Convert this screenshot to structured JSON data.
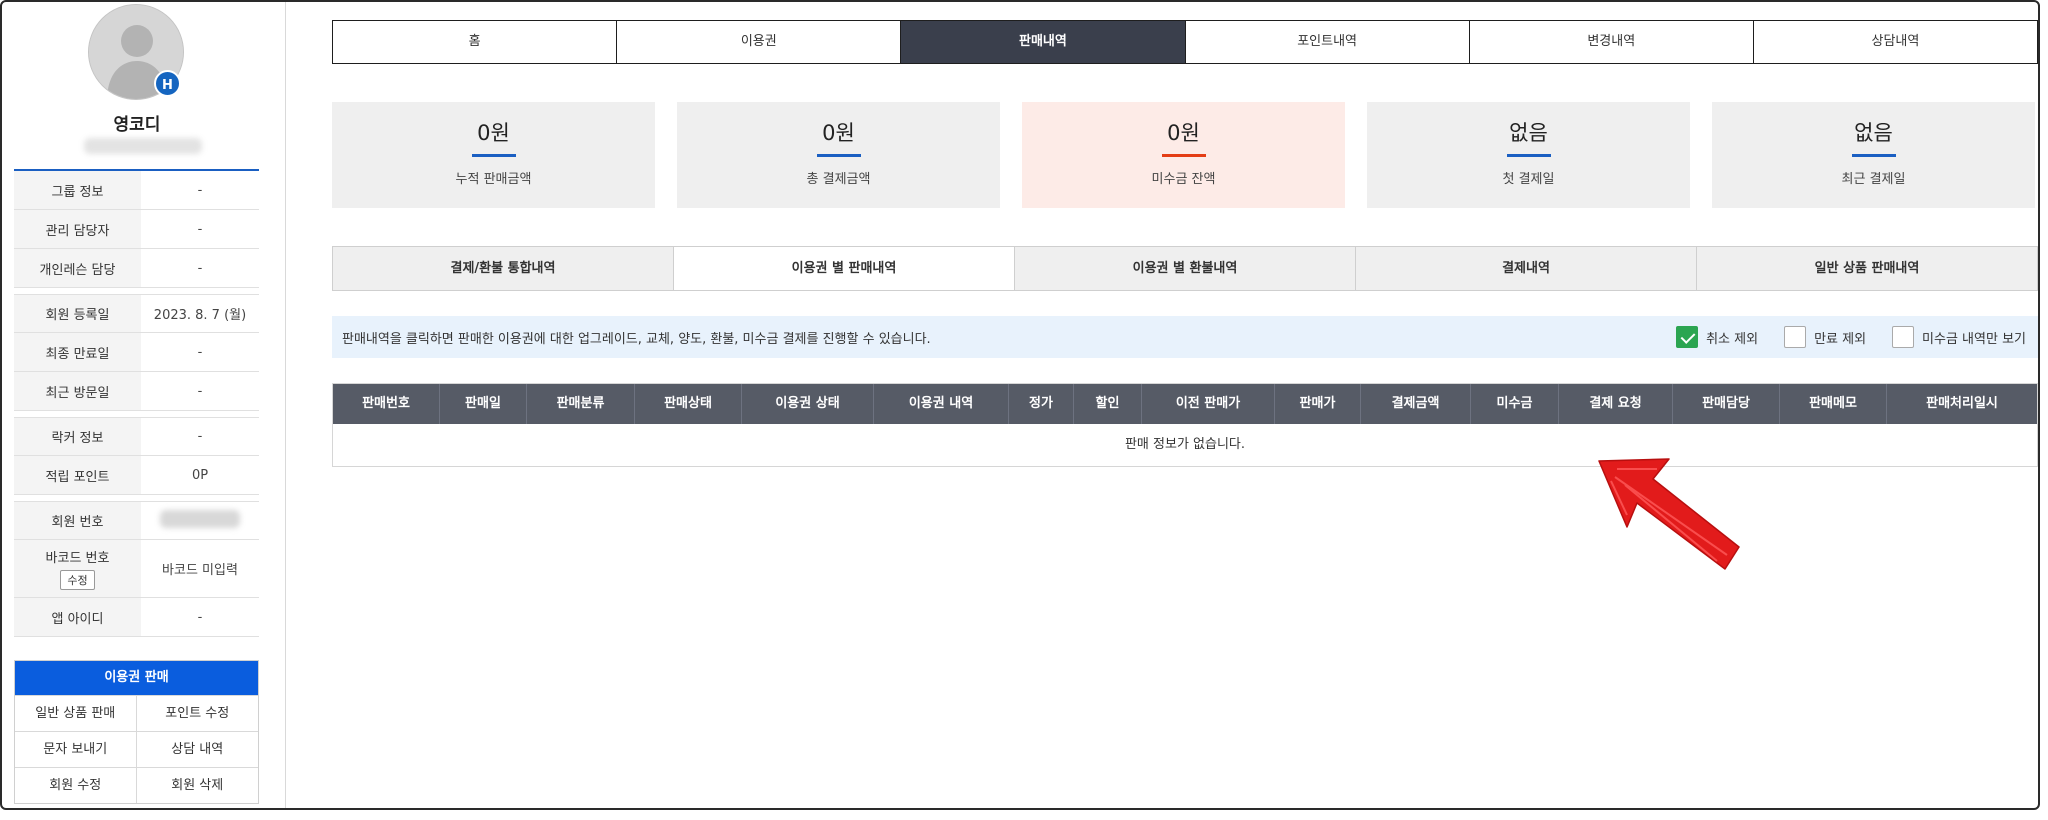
{
  "profile": {
    "badge": "H",
    "name": "영코디"
  },
  "info_rows": [
    {
      "label": "그룹 정보",
      "value": "-"
    },
    {
      "label": "관리 담당자",
      "value": "-"
    },
    {
      "label": "개인레슨 담당",
      "value": "-"
    },
    {
      "label": "회원 등록일",
      "value": "2023. 8. 7 (월)"
    },
    {
      "label": "최종 만료일",
      "value": "-"
    },
    {
      "label": "최근 방문일",
      "value": "-"
    },
    {
      "label": "락커 정보",
      "value": "-"
    },
    {
      "label": "적립 포인트",
      "value": "0P"
    },
    {
      "label": "회원 번호",
      "value": ""
    },
    {
      "label": "바코드 번호",
      "value": "바코드 미입력",
      "button": "수정"
    },
    {
      "label": "앱 아이디",
      "value": "-"
    }
  ],
  "actions": {
    "header": "이용권 판매",
    "items": [
      "일반 상품 판매",
      "포인트 수정",
      "문자 보내기",
      "상담 내역",
      "회원 수정",
      "회원 삭제"
    ]
  },
  "top_tabs": [
    "홈",
    "이용권",
    "판매내역",
    "포인트내역",
    "변경내역",
    "상담내역"
  ],
  "active_top_tab": "판매내역",
  "summary_cards": [
    {
      "value": "0원",
      "label": "누적 판매금액"
    },
    {
      "value": "0원",
      "label": "총 결제금액"
    },
    {
      "value": "0원",
      "label": "미수금 잔액"
    },
    {
      "value": "없음",
      "label": "첫 결제일"
    },
    {
      "value": "없음",
      "label": "최근 결제일"
    }
  ],
  "sub_tabs": [
    "결제/환불 통합내역",
    "이용권 별 판매내역",
    "이용권 별 환불내역",
    "결제내역",
    "일반 상품 판매내역"
  ],
  "active_sub_tab": "이용권 별 판매내역",
  "notice": "판매내역을 클릭하면 판매한 이용권에 대한 업그레이드, 교체, 양도, 환불, 미수금 결제를 진행할 수 있습니다.",
  "filters": [
    {
      "label": "취소 제외",
      "checked": true
    },
    {
      "label": "만료 제외",
      "checked": false
    },
    {
      "label": "미수금 내역만 보기",
      "checked": false
    }
  ],
  "table": {
    "columns": [
      "판매번호",
      "판매일",
      "판매분류",
      "판매상태",
      "이용권 상태",
      "이용권 내역",
      "정가",
      "할인",
      "이전 판매가",
      "판매가",
      "결제금액",
      "미수금",
      "결제 요청",
      "판매담당",
      "판매메모",
      "판매처리일시"
    ],
    "empty_message": "판매 정보가 없습니다."
  },
  "colors": {
    "brand_blue": "#0a5dde",
    "active_tab": "#3a3f4c",
    "alert_red": "#e43d15",
    "check_green": "#2ba551",
    "annotation_arrow": "#e21b1b"
  }
}
